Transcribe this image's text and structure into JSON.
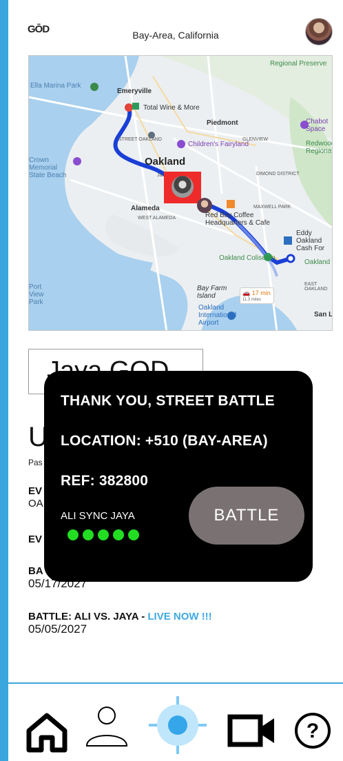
{
  "header": {
    "logo_text": "GŌD",
    "location": "Bay-Area, California"
  },
  "map": {
    "labels": {
      "emeryville": "Emeryville",
      "total_wine": "Total Wine & More",
      "piedmont": "Piedmont",
      "marina_park": "Ella Marina Park",
      "street_oakland": "STREET OAKLAND",
      "childrens_fairyland": "Children's Fairyland",
      "oakland": "Oakland",
      "jack_london": "Jack London",
      "alameda": "Alameda",
      "west_alameda": "WEST ALAMEDA",
      "redbay": "Red Bay Coffee Headquarters & Cafe",
      "oakland_coliseum": "Oakland Coliseum",
      "bay_farm": "Bay Farm Island",
      "oakland_airport": "Oakland International Airport",
      "regional_preserve": "Regional Preserve",
      "chabot": "Chabot Space",
      "redwood": "Redwood Regional",
      "eddy": "Eddy Oakland Cash For",
      "san_leandro": "San L",
      "dimond": "DIMOND DISTRICT",
      "maxwell": "MAXWELL PARK",
      "east_oakland": "EAST OAKLAND",
      "crown_beach": "Crown Memorial State Beach",
      "port_park": "Port View Park",
      "oakland_right": "Oakland",
      "glenview": "GLENVIEW"
    },
    "eta_time": "17 min",
    "eta_dist": "11.3 miles"
  },
  "name_field": {
    "value": "Jaya GOD"
  },
  "section": {
    "title": "U",
    "past_label": "Pas"
  },
  "events": [
    {
      "title": "EV",
      "sub": "OA"
    },
    {
      "title": "EV",
      "sub": ""
    },
    {
      "title": "BA",
      "date": "05/17/2027"
    },
    {
      "title": "BATTLE: ALI VS. JAYA - ",
      "live": "LIVE NOW !!!",
      "date": "05/05/2027"
    }
  ],
  "popup": {
    "line1": "THANK  YOU, STREET BATTLE",
    "line2": "LOCATION: +510 (BAY-AREA)",
    "line3": "REF: 382800",
    "sync_text": "ALI SYNC JAYA",
    "sync_dots": 5,
    "battle_button": "BATTLE"
  },
  "colors": {
    "accent_blue": "#3aa6dd",
    "live_blue": "#3fa9e2",
    "marker_red": "#ef2a2a",
    "dot_green": "#22dd22",
    "button_gray": "#7a7272"
  },
  "nav": [
    {
      "name": "home",
      "icon": "home-icon"
    },
    {
      "name": "profile",
      "icon": "user-icon"
    },
    {
      "name": "location",
      "icon": "crosshair-icon"
    },
    {
      "name": "video",
      "icon": "video-camera-icon"
    },
    {
      "name": "help",
      "icon": "help-icon"
    }
  ]
}
